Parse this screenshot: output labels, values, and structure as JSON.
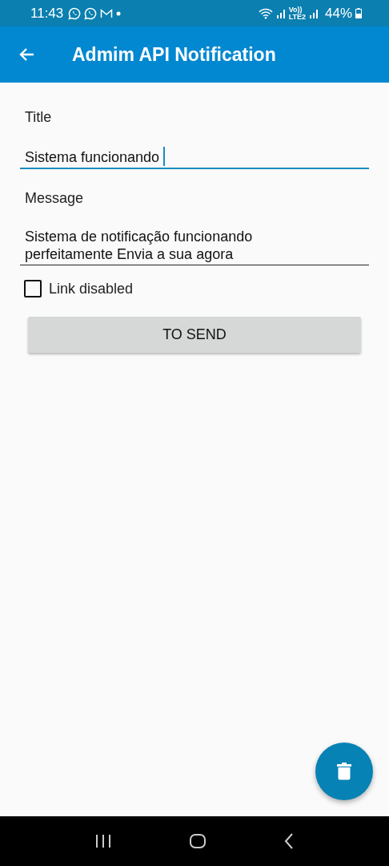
{
  "status_bar": {
    "time": "11:43",
    "volte_top": "Vo))",
    "volte_bottom": "LTE2",
    "battery": "44%"
  },
  "app_bar": {
    "title": "Admim API Notification"
  },
  "form": {
    "fields": [
      {
        "label": "Title",
        "value": "Sistema funcionando",
        "focused": true
      },
      {
        "label": "Message",
        "value": "Sistema de notificação funcionando perfeitamente Envia a sua agora",
        "focused": false
      }
    ],
    "checkbox": {
      "label": "Link disabled",
      "checked": false
    },
    "button": "TO SEND"
  }
}
